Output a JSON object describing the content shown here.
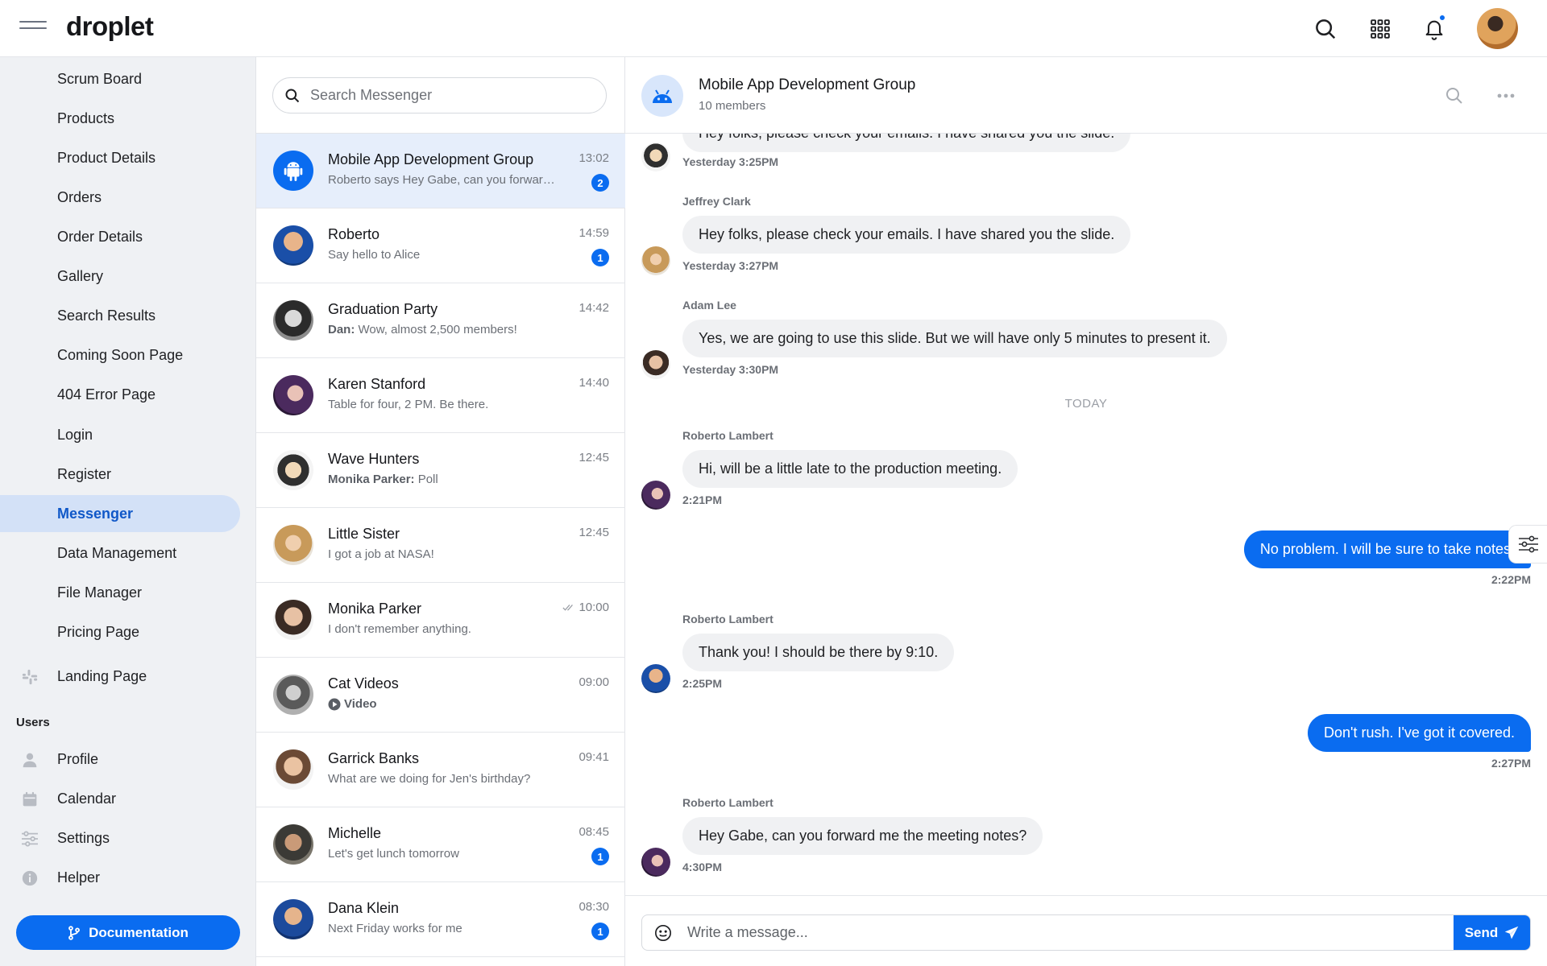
{
  "app": {
    "logo": "droplet"
  },
  "nav": {
    "items": [
      {
        "label": "Scrum Board"
      },
      {
        "label": "Products"
      },
      {
        "label": "Product Details"
      },
      {
        "label": "Orders"
      },
      {
        "label": "Order Details"
      },
      {
        "label": "Gallery"
      },
      {
        "label": "Search Results"
      },
      {
        "label": "Coming Soon Page"
      },
      {
        "label": "404 Error Page"
      },
      {
        "label": "Login"
      },
      {
        "label": "Register"
      },
      {
        "label": "Messenger",
        "active": true
      },
      {
        "label": "Data Management"
      },
      {
        "label": "File Manager"
      },
      {
        "label": "Pricing Page"
      }
    ],
    "landing": {
      "label": "Landing Page",
      "icon": "slack-icon"
    },
    "users_section": "Users",
    "users_items": [
      {
        "label": "Profile",
        "icon": "person-icon"
      },
      {
        "label": "Calendar",
        "icon": "calendar-icon"
      },
      {
        "label": "Settings",
        "icon": "sliders-icon"
      },
      {
        "label": "Helper",
        "icon": "info-icon"
      }
    ],
    "documentation": "Documentation"
  },
  "search": {
    "placeholder": "Search Messenger"
  },
  "conversations": [
    {
      "name": "Mobile App Development Group",
      "preview": "Roberto says Hey Gabe, can you forward me the meeting notes?",
      "time": "13:02",
      "badge": "2",
      "active": true
    },
    {
      "name": "Roberto",
      "preview": "Say hello to Alice",
      "time": "14:59",
      "badge": "1"
    },
    {
      "name": "Graduation Party",
      "preview_bold": "Dan:",
      "preview": " Wow, almost 2,500 members!",
      "time": "14:42"
    },
    {
      "name": "Karen Stanford",
      "preview": "Table for four, 2 PM. Be there.",
      "time": "14:40"
    },
    {
      "name": "Wave Hunters",
      "preview_bold": "Monika Parker:",
      "preview": " Poll",
      "time": "12:45"
    },
    {
      "name": "Little Sister",
      "preview": "I got a job at NASA!",
      "time": "12:45"
    },
    {
      "name": "Monika Parker",
      "preview": "I don't remember anything.",
      "time": "10:00",
      "read": true
    },
    {
      "name": "Cat Videos",
      "preview_bold": "Video",
      "preview": "",
      "time": "09:00",
      "video": true
    },
    {
      "name": "Garrick Banks",
      "preview": "What are we doing for Jen's birthday?",
      "time": "09:41"
    },
    {
      "name": "Michelle",
      "preview": "Let's get lunch tomorrow",
      "time": "08:45",
      "badge": "1"
    },
    {
      "name": "Dana Klein",
      "preview": "Next Friday works for me",
      "time": "08:30",
      "badge": "1"
    }
  ],
  "chat": {
    "title": "Mobile App Development Group",
    "subtitle": "10 members",
    "messages": [
      {
        "type": "in",
        "text": "Hey folks, please check your emails. I have shared you the slide.",
        "time": "Yesterday 3:25PM"
      },
      {
        "type": "in",
        "sender": "Jeffrey Clark",
        "text": "Hey folks, please check your emails. I have shared you the slide.",
        "time": "Yesterday 3:27PM"
      },
      {
        "type": "in",
        "sender": "Adam Lee",
        "text": "Yes, we are going to use this slide. But we will have only 5 minutes to present it.",
        "time": "Yesterday 3:30PM"
      },
      {
        "type": "sep",
        "text": "TODAY"
      },
      {
        "type": "in",
        "sender": "Roberto Lambert",
        "text": "Hi, will be a little late to the production meeting.",
        "time": "2:21PM"
      },
      {
        "type": "out",
        "text": "No problem. I will be sure to take notes.",
        "time": "2:22PM"
      },
      {
        "type": "in",
        "sender": "Roberto Lambert",
        "text": "Thank you! I should be there by 9:10.",
        "time": "2:25PM"
      },
      {
        "type": "out",
        "text": "Don't rush. I've got it covered.",
        "time": "2:27PM"
      },
      {
        "type": "in",
        "sender": "Roberto Lambert",
        "text": "Hey Gabe, can you forward me the meeting notes?",
        "time": "4:30PM"
      }
    ],
    "composer_placeholder": "Write a message...",
    "send_label": "Send"
  },
  "colors": {
    "accent": "#0a6cf0",
    "nav_bg": "#eff1f4",
    "active_nav": "#d3e1f7",
    "bubble_in": "#f0f1f3"
  }
}
